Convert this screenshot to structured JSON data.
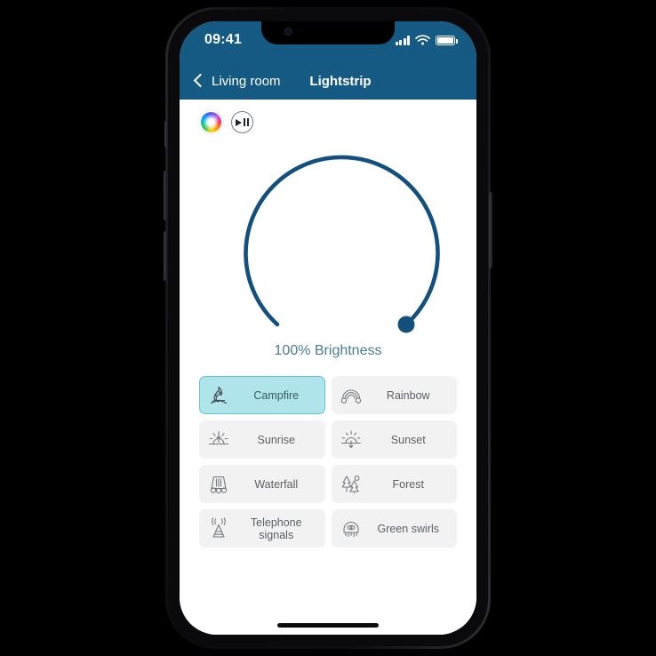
{
  "status_bar": {
    "time": "09:41",
    "icons": [
      "cellular-signal-icon",
      "wifi-icon",
      "battery-icon"
    ]
  },
  "nav": {
    "back_label": "Living room",
    "back_icon": "chevron-left-icon",
    "title": "Lightstrip"
  },
  "quick_actions": {
    "color_wheel": "color-wheel-icon",
    "play_pause": "play-pause-icon"
  },
  "dial": {
    "brightness_label": "100% Brightness",
    "value_percent": 100,
    "track_color": "#14507d",
    "knob_color": "#14507d"
  },
  "presets": [
    {
      "label": "Campfire",
      "icon": "campfire-icon",
      "selected": true
    },
    {
      "label": "Rainbow",
      "icon": "rainbow-icon",
      "selected": false
    },
    {
      "label": "Sunrise",
      "icon": "sunrise-icon",
      "selected": false
    },
    {
      "label": "Sunset",
      "icon": "sunset-icon",
      "selected": false
    },
    {
      "label": "Waterfall",
      "icon": "waterfall-icon",
      "selected": false
    },
    {
      "label": "Forest",
      "icon": "forest-icon",
      "selected": false
    },
    {
      "label": "Telephone signals",
      "icon": "antenna-tower-icon",
      "selected": false
    },
    {
      "label": "Green swirls",
      "icon": "jellyfish-icon",
      "selected": false
    }
  ],
  "colors": {
    "header": "#145a82",
    "accent": "#14507d",
    "selected_tile_bg": "#aee4ea",
    "selected_tile_border": "#62c5d1",
    "tile_bg": "#f2f2f2"
  }
}
